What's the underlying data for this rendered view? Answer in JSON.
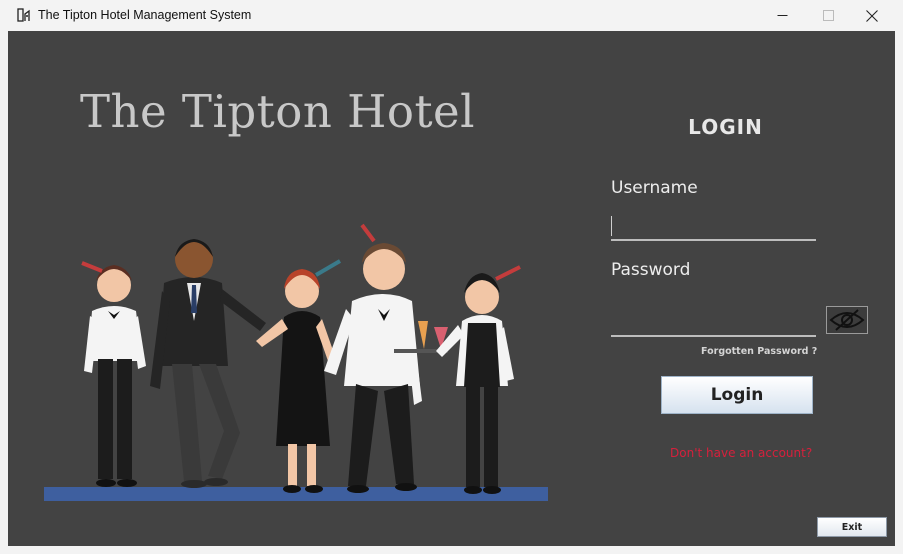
{
  "window": {
    "title": "The Tipton Hotel Management System",
    "icons": {
      "app": "hotel-app-icon",
      "minimize": "minimize-icon",
      "maximize": "maximize-icon",
      "close": "close-icon"
    }
  },
  "brand": {
    "hotel_name": "The Tipton Hotel"
  },
  "login": {
    "heading": "LOGIN",
    "username_label": "Username",
    "username_value": "",
    "password_label": "Password",
    "password_value": "",
    "show_password_icon": "eye-slash-icon",
    "forgot_link": "Forgotten Password ?",
    "login_button": "Login",
    "signup_link": "Don't have an account?"
  },
  "footer": {
    "exit_button": "Exit"
  },
  "colors": {
    "panel_bg": "#434343",
    "title_text": "#c8c8c8",
    "link_red": "#d6203c",
    "floor_blue": "#3e5f9f"
  }
}
